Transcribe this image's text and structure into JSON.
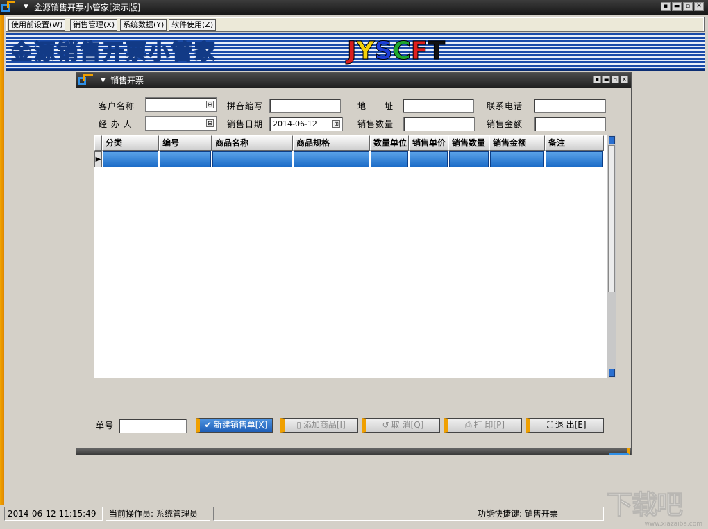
{
  "app": {
    "title": "金源销售开票小管家[演示版]",
    "controls": [
      "▪",
      "▬",
      "▫",
      "✕"
    ]
  },
  "menu": {
    "items": [
      "使用前设置(W)",
      "销售管理(X)",
      "系统数据(Y)",
      "软件使用(Z)"
    ]
  },
  "banner": {
    "title": "金源销售开票小管家",
    "brand_letters": [
      "J",
      "Y",
      "S",
      "C",
      "F",
      "T"
    ],
    "brand_colors": [
      "#d81e1e",
      "#f5d20a",
      "#1e3ed8",
      "#1ea82e",
      "#e01e1e",
      "#111111"
    ]
  },
  "child_window": {
    "title": "销售开票",
    "form": {
      "customer_label": "客户名称",
      "customer_value": "",
      "pinyin_label": "拼音缩写",
      "pinyin_value": "",
      "address_label": "地　　址",
      "address_value": "",
      "phone_label": "联系电话",
      "phone_value": "",
      "handler_label": "经 办 人",
      "handler_value": "",
      "date_label": "销售日期",
      "date_value": "2014-06-12",
      "qty_label": "销售数量",
      "qty_value": "",
      "amount_label": "销售金额",
      "amount_value": ""
    },
    "grid": {
      "columns": [
        "分类",
        "编号",
        "商品名称",
        "商品规格",
        "数量单位",
        "销售单价",
        "销售数量",
        "销售金额",
        "备注"
      ],
      "selected_row_indicator": "▶"
    },
    "bottom": {
      "order_no_label": "单号",
      "order_no_value": "",
      "buttons": {
        "new": {
          "icon": "✔",
          "label": "新建销售单[X]"
        },
        "add": {
          "icon": "▯",
          "label": "添加商品[I]"
        },
        "cancel": {
          "icon": "↺",
          "label": "取 消[Q]"
        },
        "print": {
          "icon": "⎙",
          "label": "打 印[P]"
        },
        "exit": {
          "icon": "⛶",
          "label": "退 出[E]"
        }
      }
    }
  },
  "status": {
    "datetime": "2014-06-12 11:15:49",
    "operator": "当前操作员: 系统管理员",
    "shortcut": "功能快捷键: 销售开票"
  },
  "watermark": {
    "text": "下载吧",
    "sub": "www.xiazaiba.com"
  }
}
